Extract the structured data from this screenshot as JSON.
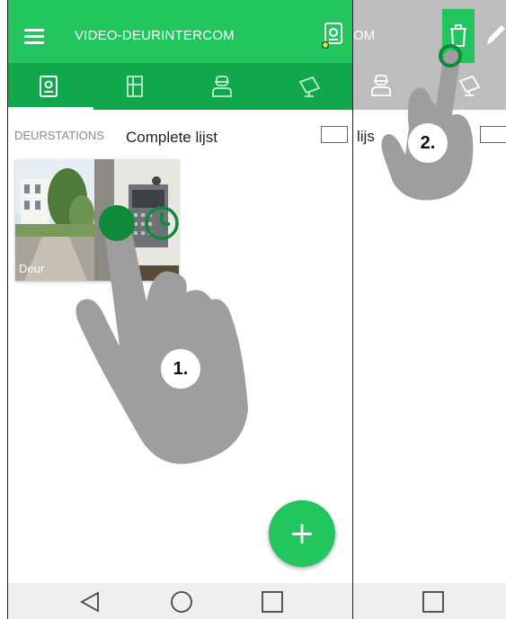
{
  "left_screen": {
    "app_title": "VIDEO-DEURINTERCOM",
    "tabs": [
      {
        "icon": "intercom-panel-icon",
        "active": true
      },
      {
        "icon": "door-icon",
        "active": false
      },
      {
        "icon": "person-icon",
        "active": false
      },
      {
        "icon": "camera-icon",
        "active": false
      }
    ],
    "section_label": "DEURSTATIONS",
    "list_label": "Complete lijst",
    "thumbnail": {
      "label": "Deur"
    },
    "fab_label": "+",
    "step_label": "1."
  },
  "right_screen": {
    "title_fragment": "OM",
    "list_fragment": "lijs",
    "step_label": "2."
  },
  "colors": {
    "appbar_green": "#22c55e",
    "tabbar_green": "#10a84a",
    "dark_green_icon": "#0f8a3a",
    "hand_gray": "#9e9e9e",
    "inactive_gray": "#bdbdbd"
  }
}
